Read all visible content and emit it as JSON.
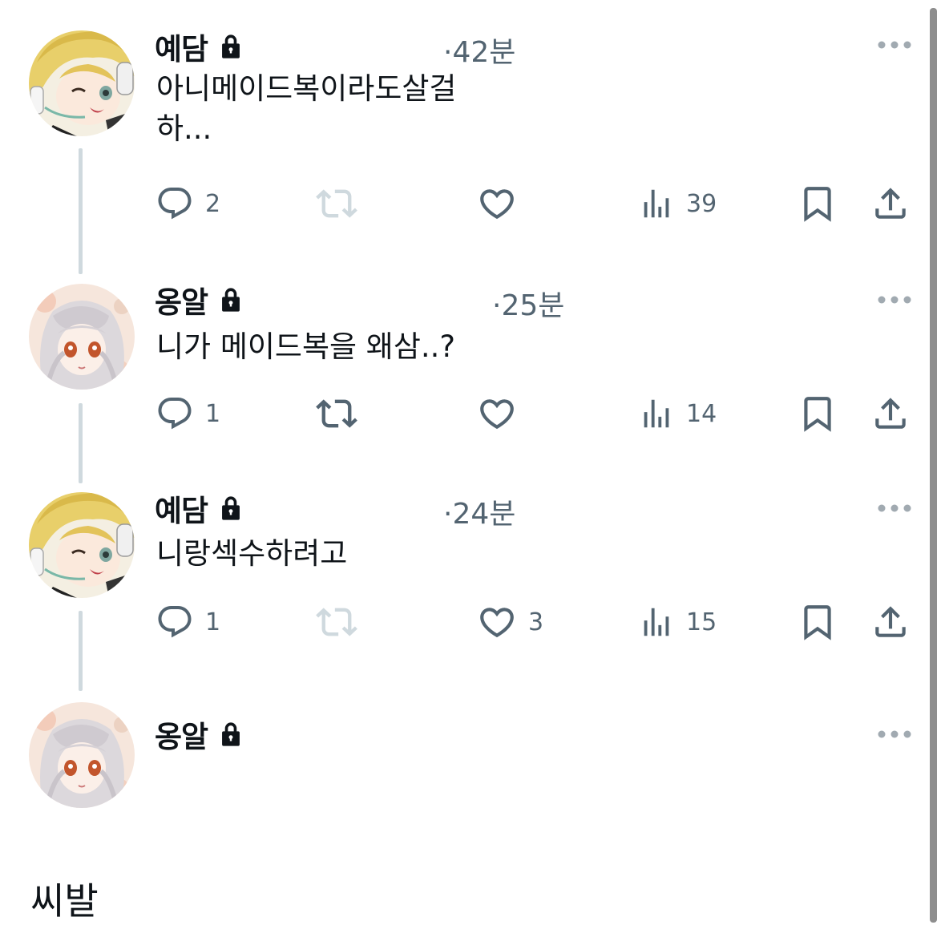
{
  "tweets": [
    {
      "name": "예담",
      "time": "·42분",
      "text": "아니메이드복이라도살걸\n하...",
      "reply_count": "2",
      "retweet_count": "",
      "like_count": "",
      "view_count": "39",
      "avatar": "blonde-character-avatar"
    },
    {
      "name": "옹알",
      "time": "·25분",
      "text": "니가 메이드복을 왜삼..?",
      "reply_count": "1",
      "retweet_count": "",
      "like_count": "",
      "view_count": "14",
      "avatar": "silver-hair-character-avatar"
    },
    {
      "name": "예담",
      "time": "·24분",
      "text": "니랑섹수하려고",
      "reply_count": "1",
      "retweet_count": "",
      "like_count": "3",
      "view_count": "15",
      "avatar": "blonde-character-avatar"
    },
    {
      "name": "옹알",
      "time": "",
      "text": "씨발",
      "avatar": "silver-hair-character-avatar"
    }
  ],
  "icons": {
    "reply": "reply-icon",
    "retweet": "retweet-icon",
    "like": "heart-icon",
    "views": "views-icon",
    "bookmark": "bookmark-icon",
    "share": "share-icon",
    "lock": "lock-icon",
    "more": "more-icon"
  },
  "colors": {
    "text": "#0f1419",
    "secondary": "#536471",
    "thread_line": "#cfd9de",
    "icon_disabled": "#cfd9de"
  }
}
